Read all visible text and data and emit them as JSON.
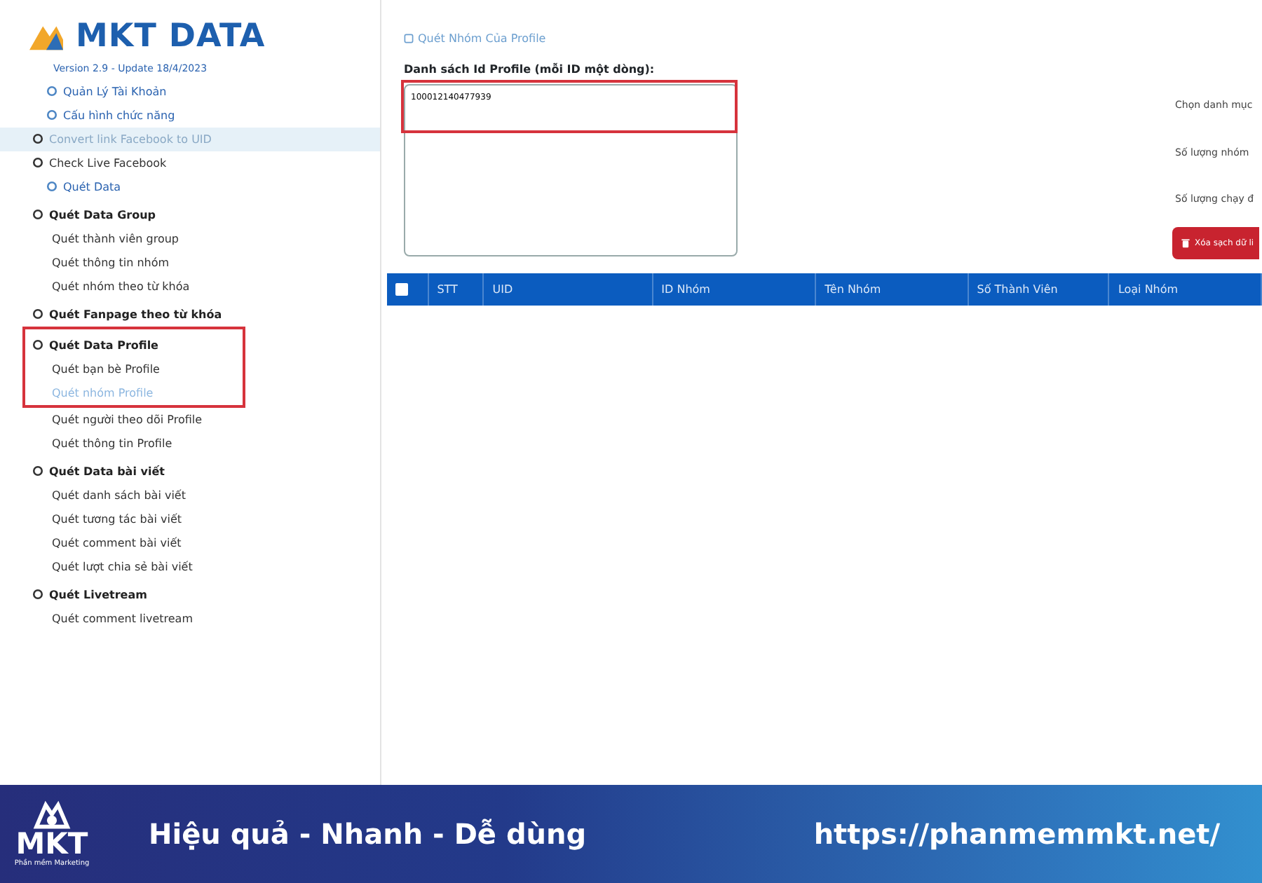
{
  "logo": {
    "text": "MKT DATA",
    "version": "Version 2.9 - Update 18/4/2023"
  },
  "sidebar": {
    "items": [
      {
        "label": "Quản Lý Tài Khoản",
        "kind": "link",
        "hovered": false,
        "selected": false,
        "marked": false
      },
      {
        "label": "Cấu hình chức năng",
        "kind": "link",
        "hovered": false,
        "selected": false,
        "marked": false
      },
      {
        "label": "Convert link Facebook to UID",
        "kind": "item",
        "hovered": true,
        "selected": false,
        "marked": false
      },
      {
        "label": "Check Live Facebook",
        "kind": "item",
        "hovered": false,
        "selected": false,
        "marked": false
      },
      {
        "label": "Quét Data",
        "kind": "link",
        "hovered": false,
        "selected": false,
        "marked": false
      },
      {
        "label": "Quét Data Group",
        "kind": "header",
        "hovered": false,
        "selected": false,
        "marked": false
      },
      {
        "label": "Quét thành viên group",
        "kind": "sub",
        "hovered": false,
        "selected": false,
        "marked": false
      },
      {
        "label": "Quét thông tin nhóm",
        "kind": "sub",
        "hovered": false,
        "selected": false,
        "marked": false
      },
      {
        "label": "Quét nhóm theo từ khóa",
        "kind": "sub",
        "hovered": false,
        "selected": false,
        "marked": false
      },
      {
        "label": "Quét Fanpage theo từ khóa",
        "kind": "header",
        "hovered": false,
        "selected": false,
        "marked": false
      },
      {
        "label": "Quét Data Profile",
        "kind": "header",
        "hovered": false,
        "selected": false,
        "marked": true
      },
      {
        "label": "Quét bạn bè Profile",
        "kind": "sub",
        "hovered": false,
        "selected": false,
        "marked": true
      },
      {
        "label": "Quét nhóm Profile",
        "kind": "sub",
        "hovered": false,
        "selected": true,
        "marked": true
      },
      {
        "label": "Quét người theo dõi Profile",
        "kind": "sub",
        "hovered": false,
        "selected": false,
        "marked": false
      },
      {
        "label": "Quét thông tin Profile",
        "kind": "sub",
        "hovered": false,
        "selected": false,
        "marked": false
      },
      {
        "label": "Quét Data bài viết",
        "kind": "header",
        "hovered": false,
        "selected": false,
        "marked": false
      },
      {
        "label": "Quét danh sách bài viết",
        "kind": "sub",
        "hovered": false,
        "selected": false,
        "marked": false
      },
      {
        "label": "Quét tương tác bài viết",
        "kind": "sub",
        "hovered": false,
        "selected": false,
        "marked": false
      },
      {
        "label": "Quét comment bài viết",
        "kind": "sub",
        "hovered": false,
        "selected": false,
        "marked": false
      },
      {
        "label": "Quét lượt chia sẻ bài viết",
        "kind": "sub",
        "hovered": false,
        "selected": false,
        "marked": false
      },
      {
        "label": "Quét Livetream",
        "kind": "header",
        "hovered": false,
        "selected": false,
        "marked": false
      },
      {
        "label": "Quét comment livetream",
        "kind": "sub",
        "hovered": false,
        "selected": false,
        "marked": false
      }
    ]
  },
  "main": {
    "title": "Quét Nhóm Của Profile",
    "field_label": "Danh sách Id Profile (mỗi ID một dòng):",
    "field_value": "100012140477939",
    "field_marked": true,
    "options": [
      "Chọn danh mục",
      "Số lượng nhóm",
      "Số lượng chạy đ"
    ],
    "clear_button": "Xóa sạch dữ li",
    "table": {
      "header_checked": false,
      "columns": [
        "STT",
        "UID",
        "ID Nhóm",
        "Tên Nhóm",
        "Số Thành Viên",
        "Loại Nhóm"
      ]
    }
  },
  "banner": {
    "logo_text": "MKT",
    "logo_caption": "Phần mềm Marketing",
    "tagline": "Hiệu quả - Nhanh - Dễ dùng",
    "url": "https://phanmemmkt.net/"
  }
}
